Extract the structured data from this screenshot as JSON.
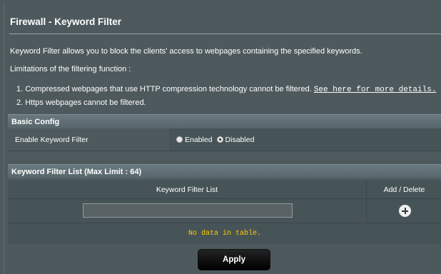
{
  "header": {
    "title": "Firewall - Keyword Filter"
  },
  "description": {
    "intro": "Keyword Filter allows you to block the clients' access to webpages containing the specified keywords.",
    "limitations_heading": "Limitations of the filtering function :",
    "item1_text": "1. Compressed webpages that use HTTP compression technology cannot be filtered.",
    "item1_link": "See here for more details.",
    "item2_text": "2. Https webpages cannot be filtered."
  },
  "basic_config": {
    "heading": "Basic Config",
    "enable_label": "Enable Keyword Filter",
    "options": [
      {
        "label": "Enabled",
        "checked": false
      },
      {
        "label": "Disabled",
        "checked": true
      }
    ]
  },
  "filter_list": {
    "heading": "Keyword Filter List (Max Limit : 64)",
    "col_keyword": "Keyword Filter List",
    "col_action": "Add / Delete",
    "input_value": "",
    "empty_text": "No data in table."
  },
  "apply_label": "Apply",
  "colors": {
    "background": "#4d595d",
    "empty_text": "#ffcc00"
  }
}
